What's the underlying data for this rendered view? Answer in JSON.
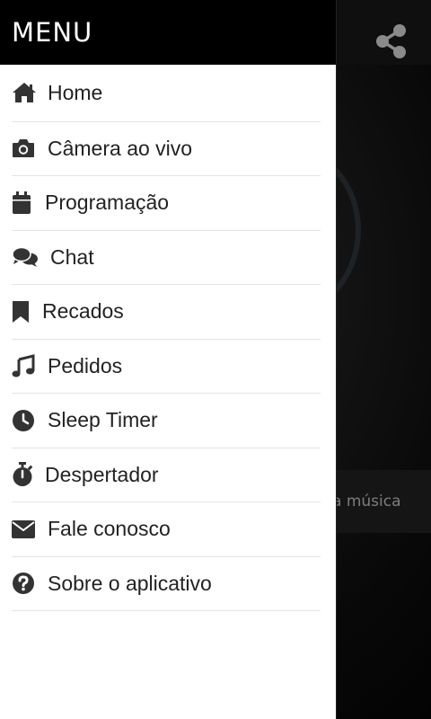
{
  "app": {
    "background_text": "a música",
    "share_icon": "share-icon"
  },
  "drawer": {
    "title": "MENU",
    "items": [
      {
        "label": "Home",
        "icon": "home-icon"
      },
      {
        "label": "Câmera ao vivo",
        "icon": "camera-icon"
      },
      {
        "label": "Programação",
        "icon": "calendar-icon"
      },
      {
        "label": "Chat",
        "icon": "chat-icon"
      },
      {
        "label": "Recados",
        "icon": "bookmark-icon"
      },
      {
        "label": "Pedidos",
        "icon": "music-note-icon"
      },
      {
        "label": "Sleep Timer",
        "icon": "clock-icon"
      },
      {
        "label": "Despertador",
        "icon": "stopwatch-icon"
      },
      {
        "label": "Fale conosco",
        "icon": "envelope-icon"
      },
      {
        "label": "Sobre o aplicativo",
        "icon": "help-circle-icon"
      }
    ]
  },
  "colors": {
    "header_bg": "#000000",
    "drawer_bg": "#ffffff",
    "text": "#222222",
    "divider": "#e4e4e4"
  }
}
